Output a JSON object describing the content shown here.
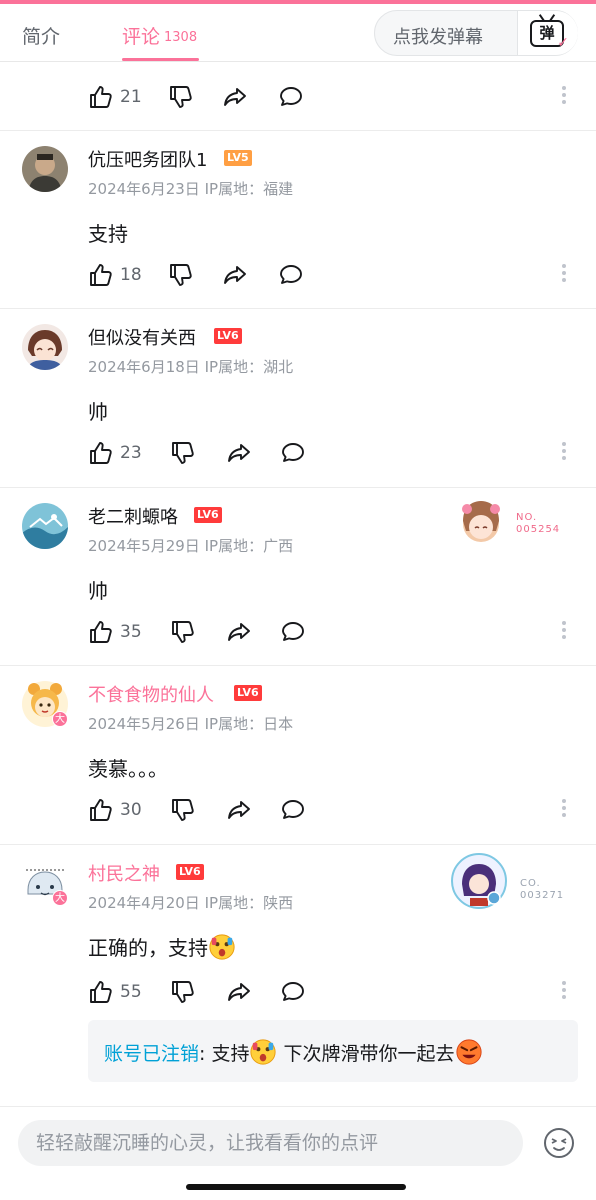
{
  "tabs": {
    "intro": "简介",
    "comments": "评论",
    "comments_count": "1308",
    "danmaku_placeholder": "点我发弹幕",
    "danmaku_icon_label": "弹"
  },
  "top_comment": {
    "likes": "21"
  },
  "comments": [
    {
      "user": "伉压吧务团队1",
      "level": "LV5",
      "date": "2024年6月23日",
      "ip": "IP属地：福建",
      "text": "支持",
      "likes": "18"
    },
    {
      "user": "但似没有关西",
      "level": "LV6",
      "date": "2024年6月18日",
      "ip": "IP属地：湖北",
      "text": "帅",
      "likes": "23"
    },
    {
      "user": "老二刺螈咯",
      "level": "LV6",
      "date": "2024年5月29日",
      "ip": "IP属地：广西",
      "text": "帅",
      "likes": "35",
      "fan_badge": "NO.\n005254"
    },
    {
      "user": "不食食物的仙人",
      "level": "LV6",
      "date": "2024年5月26日",
      "ip": "IP属地：日本",
      "text": "羡慕。。。",
      "likes": "30",
      "avatar_badge": "大"
    },
    {
      "user": "村民之神",
      "level": "LV6",
      "date": "2024年4月20日",
      "ip": "IP属地：陕西",
      "text": "正确的，支持",
      "likes": "55",
      "avatar_badge": "大",
      "fan_badge": "CO.\n003271"
    }
  ],
  "reply": {
    "user": "账号已注销",
    "sep": ": 支持",
    "text": "下次牌滑带你一起去"
  },
  "input": {
    "placeholder": "轻轻敲醒沉睡的心灵，让我看看你的点评"
  },
  "colors": {
    "accent": "#fb7299",
    "link": "#00a1d6"
  }
}
